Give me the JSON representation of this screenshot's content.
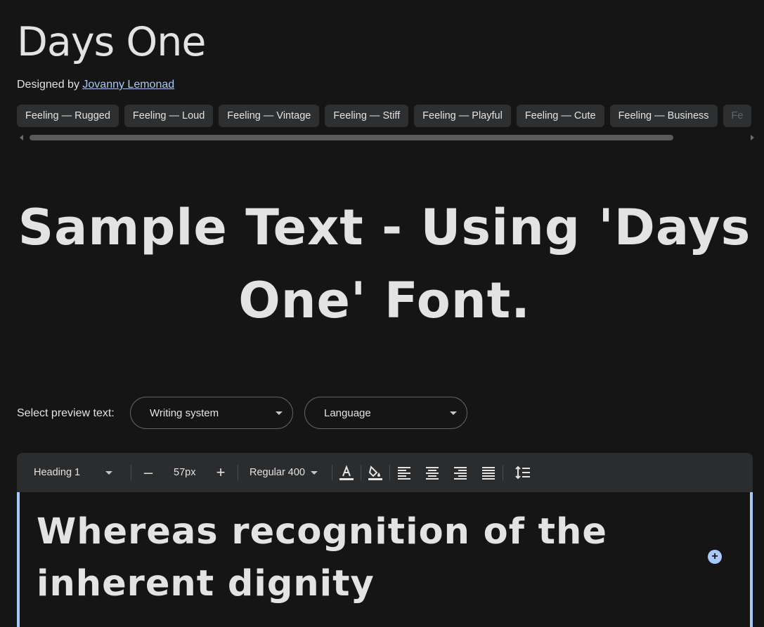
{
  "header": {
    "font_name": "Days One",
    "designed_by_prefix": "Designed by ",
    "designer_name": "Jovanny Lemonad"
  },
  "tags": [
    "Feeling — Rugged",
    "Feeling — Loud",
    "Feeling — Vintage",
    "Feeling — Stiff",
    "Feeling — Playful",
    "Feeling — Cute",
    "Feeling — Business",
    "Fe"
  ],
  "sample": {
    "text": "Sample Text - Using 'Days One' Font."
  },
  "preview": {
    "label": "Select preview text:",
    "writing_system": "Writing system",
    "language": "Language"
  },
  "toolbar": {
    "style": "Heading 1",
    "decrease_icon": "minus-icon",
    "size": "57px",
    "increase_icon": "plus-icon",
    "weight": "Regular 400",
    "icons": [
      "text-color-icon",
      "highlight-fill-icon",
      "align-left-icon",
      "align-center-icon",
      "align-right-icon",
      "align-justify-icon",
      "line-height-icon"
    ]
  },
  "editor": {
    "text": "Whereas recognition of the inherent dignity",
    "add_icon": "add-circle-icon"
  },
  "colors": {
    "background": "#151515",
    "text": "#e3e3e3",
    "accent": "#a8c7fa",
    "chip_bg": "#2d2f31",
    "toolbar_bg": "#2b2c2e"
  }
}
